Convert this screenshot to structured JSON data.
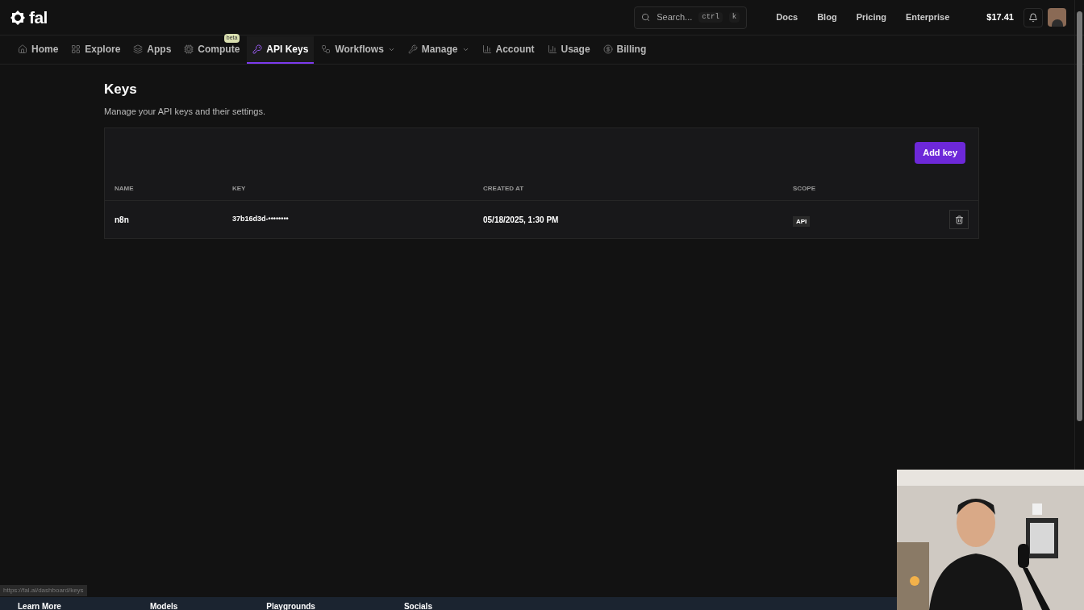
{
  "header": {
    "logo": "fal",
    "search": {
      "placeholder": "Search...",
      "shortcut": [
        "ctrl",
        "k"
      ]
    },
    "links": [
      "Docs",
      "Blog",
      "Pricing",
      "Enterprise"
    ],
    "balance": "$17.41"
  },
  "nav": [
    {
      "label": "Home",
      "selected": false
    },
    {
      "label": "Explore",
      "selected": false
    },
    {
      "label": "Apps",
      "selected": false
    },
    {
      "label": "Compute",
      "selected": false,
      "badge": "beta"
    },
    {
      "label": "API Keys",
      "selected": true
    },
    {
      "label": "Workflows",
      "selected": false,
      "dropdown": true
    },
    {
      "label": "Manage",
      "selected": false,
      "dropdown": true
    },
    {
      "label": "Account",
      "selected": false
    },
    {
      "label": "Usage",
      "selected": false
    },
    {
      "label": "Billing",
      "selected": false
    }
  ],
  "page": {
    "title": "Keys",
    "subtitle": "Manage your API keys and their settings.",
    "add_button": "Add key"
  },
  "table": {
    "columns": [
      "NAME",
      "KEY",
      "CREATED AT",
      "SCOPE"
    ],
    "rows": [
      {
        "name": "n8n",
        "key": "37b16d3d-••••••••",
        "created_at": "05/18/2025, 1:30 PM",
        "scope": "API"
      }
    ]
  },
  "footer": {
    "items": [
      "Learn More",
      "Models",
      "Playgrounds",
      "Socials"
    ],
    "status_url": "https://fal.ai/dashboard/keys"
  }
}
